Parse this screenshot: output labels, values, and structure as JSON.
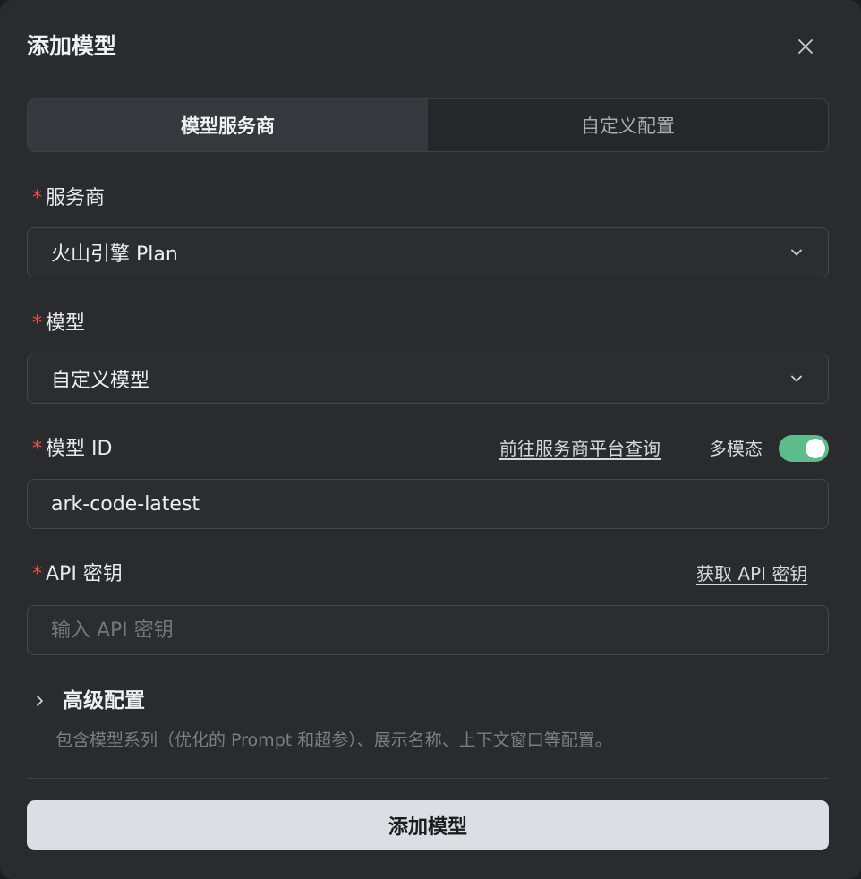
{
  "dialog": {
    "title": "添加模型"
  },
  "tabs": [
    {
      "label": "模型服务商",
      "active": true
    },
    {
      "label": "自定义配置",
      "active": false
    }
  ],
  "provider": {
    "label": "服务商",
    "required_mark": "*",
    "value": "火山引擎 Plan"
  },
  "model": {
    "label": "模型",
    "required_mark": "*",
    "value": "自定义模型"
  },
  "model_id": {
    "label": "模型 ID",
    "required_mark": "*",
    "link": "前往服务商平台查询",
    "multimodal_label": "多模态",
    "multimodal_enabled": true,
    "value": "ark-code-latest"
  },
  "api_key": {
    "label": "API 密钥",
    "required_mark": "*",
    "link": "获取 API 密钥",
    "placeholder": "输入 API 密钥",
    "value": ""
  },
  "advanced": {
    "title": "高级配置",
    "description": "包含模型系列（优化的 Prompt 和超参）、展示名称、上下文窗口等配置。"
  },
  "submit_label": "添加模型",
  "colors": {
    "background": "#2a2b2f",
    "accent_toggle": "#5dbb8c",
    "required": "#e5534b",
    "primary_button": "#dcdee3"
  }
}
